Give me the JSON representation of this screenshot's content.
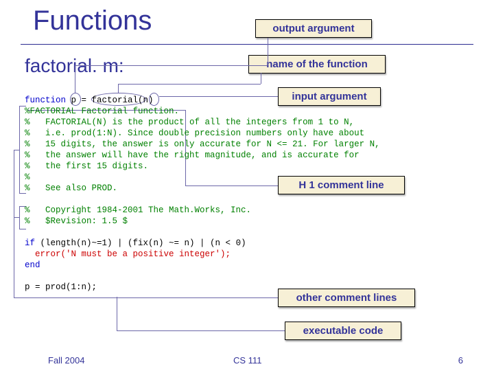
{
  "title": "Functions",
  "subtitle": "factorial. m:",
  "labels": {
    "output_arg": "output argument",
    "name_of_func": "name of the function",
    "input_arg": "input argument",
    "h1_line": "H 1 comment line",
    "other_comments": "other comment lines",
    "exec_code": "executable code"
  },
  "code": {
    "l1a": "function",
    "l1b": " p = factorial(n)",
    "l2": "%FACTORIAL Factorial function.",
    "l3": "%   FACTORIAL(N) is the product of all the integers from 1 to N,",
    "l4": "%   i.e. prod(1:N). Since double precision numbers only have about",
    "l5": "%   15 digits, the answer is only accurate for N <= 21. For larger N,",
    "l6": "%   the answer will have the right magnitude, and is accurate for",
    "l7": "%   the first 15 digits.",
    "l8": "%",
    "l9": "%   See also PROD.",
    "l10": "%   Copyright 1984-2001 The Math.Works, Inc.",
    "l11": "%   $Revision: 1.5 $",
    "l12a": "if",
    "l12b": " (length(n)~=1) | (fix(n) ~= n) | (n < 0)",
    "l13a": "  error",
    "l13b": "('N must be a positive integer');",
    "l14": "end",
    "l15": "p = prod(1:n);"
  },
  "footer": {
    "left": "Fall 2004",
    "center": "CS 111",
    "right": "6"
  }
}
